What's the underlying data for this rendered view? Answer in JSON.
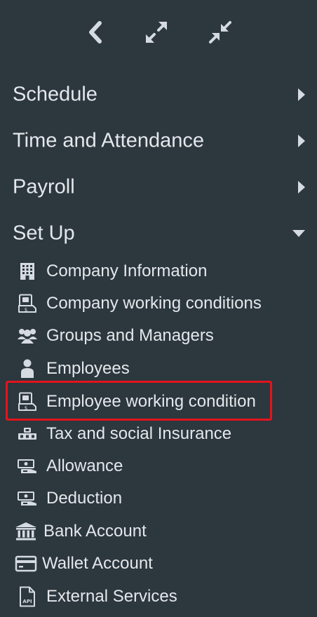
{
  "toolbar": {
    "back_icon": "chevron-left-icon",
    "expand_icon": "expand-icon",
    "collapse_icon": "compress-icon"
  },
  "colors": {
    "background": "#2c373e",
    "text": "#e4e8eb",
    "icon": "#d5dbe0",
    "highlight_border": "#e3141c"
  },
  "sections": [
    {
      "label": "Schedule",
      "state": "collapsed",
      "icon": "caret-right-icon"
    },
    {
      "label": "Time and Attendance",
      "state": "collapsed",
      "icon": "caret-right-icon"
    },
    {
      "label": "Payroll",
      "state": "collapsed",
      "icon": "caret-right-icon"
    },
    {
      "label": "Set Up",
      "state": "expanded",
      "icon": "caret-down-icon"
    }
  ],
  "setup_items": [
    {
      "label": "Company Information",
      "icon": "building-icon"
    },
    {
      "label": "Company working conditions",
      "icon": "contract-icon"
    },
    {
      "label": "Groups and Managers",
      "icon": "users-group-icon"
    },
    {
      "label": "Employees",
      "icon": "user-icon"
    },
    {
      "label": "Employee working condition",
      "icon": "contract-icon",
      "highlighted": true
    },
    {
      "label": "Tax and social Insurance",
      "icon": "tax-icon"
    },
    {
      "label": "Allowance",
      "icon": "money-icon"
    },
    {
      "label": "Deduction",
      "icon": "money-icon"
    },
    {
      "label": "Bank Account",
      "icon": "bank-icon"
    },
    {
      "label": "Wallet Account",
      "icon": "credit-card-icon"
    },
    {
      "label": "External Services",
      "icon": "api-file-icon"
    }
  ]
}
